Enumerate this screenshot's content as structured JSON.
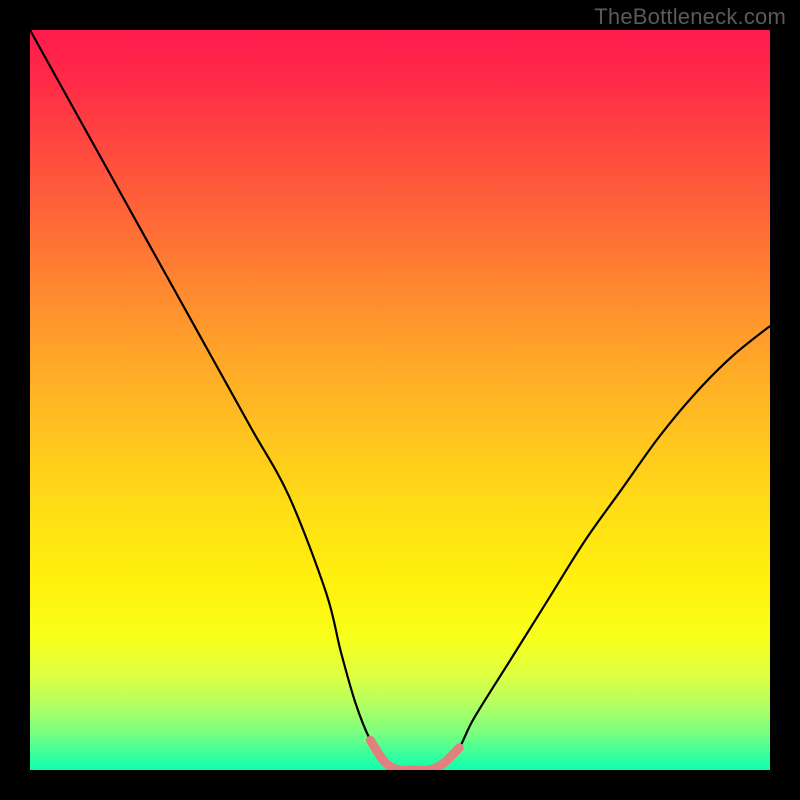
{
  "watermark": "TheBottleneck.com",
  "chart_data": {
    "type": "line",
    "title": "",
    "xlabel": "",
    "ylabel": "",
    "xlim": [
      0,
      100
    ],
    "ylim": [
      0,
      100
    ],
    "x": [
      0,
      5,
      10,
      15,
      20,
      25,
      30,
      35,
      40,
      42,
      44,
      46,
      48,
      50,
      52,
      54,
      56,
      58,
      60,
      65,
      70,
      75,
      80,
      85,
      90,
      95,
      100
    ],
    "values": [
      100,
      91,
      82,
      73,
      64,
      55,
      46,
      37,
      24,
      16,
      9,
      4,
      1,
      0,
      0,
      0,
      1,
      3,
      7,
      15,
      23,
      31,
      38,
      45,
      51,
      56,
      60
    ],
    "annotations": {
      "highlight_region_x": [
        45,
        58
      ],
      "highlight_color": "#e28080",
      "background_gradient": [
        "#ff1a4d",
        "#ffde15",
        "#10ffb0"
      ]
    }
  },
  "colors": {
    "page_bg": "#000000",
    "curve": "#000000",
    "highlight": "#e28080",
    "watermark": "#5a5a5a"
  }
}
